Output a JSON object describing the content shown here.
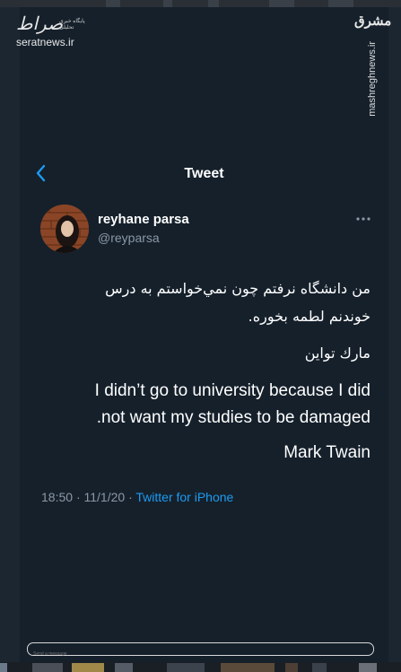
{
  "watermarks": {
    "left_script": "صراط",
    "left_tagline": "پایگاه خبری تحلیلی",
    "left_site": "seratnews.ir",
    "right_mark": "مشرق",
    "right_vertical": "mashreghnews.ir"
  },
  "header": {
    "back_icon": "chevron-left-icon",
    "title": "Tweet"
  },
  "tweet": {
    "display_name": "reyhane parsa",
    "handle": "@reyparsa",
    "more_icon": "ellipsis-icon",
    "lines_fa": [
      "من دانشگاه نرفتم چون نمي‌خواستم به درس",
      "خوندنم لطمه بخوره.",
      "مارك تواين"
    ],
    "lines_en": [
      "I didn’t go to university because I did",
      ".not want my studies to be damaged",
      "Mark Twain"
    ],
    "time": "18:50",
    "date": "11/1/20",
    "separator": "·",
    "source": "Twitter for iPhone"
  },
  "message_bar": {
    "placeholder": "Send a message"
  },
  "colors": {
    "background": "#15202b",
    "accent": "#1d9bf0",
    "secondary_text": "#8b98a5"
  }
}
